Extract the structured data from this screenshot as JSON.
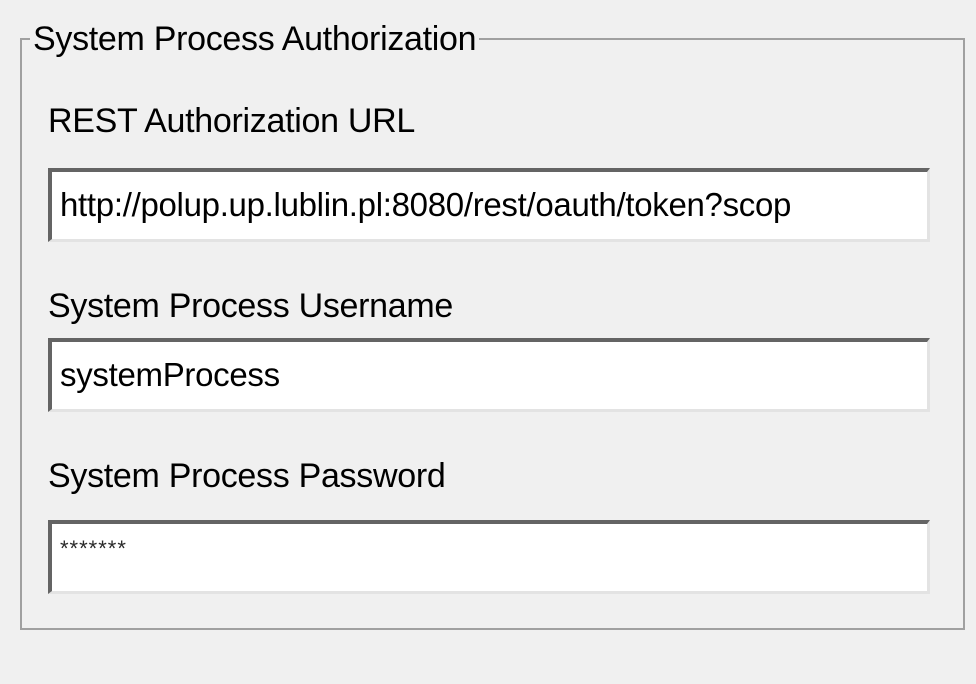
{
  "group": {
    "title": "System Process Authorization"
  },
  "fields": {
    "rest_url": {
      "label": "REST Authorization URL",
      "value": "http://polup.up.lublin.pl:8080/rest/oauth/token?scop"
    },
    "username": {
      "label": "System Process Username",
      "value": "systemProcess"
    },
    "password": {
      "label": "System Process Password",
      "value": "*******"
    }
  }
}
